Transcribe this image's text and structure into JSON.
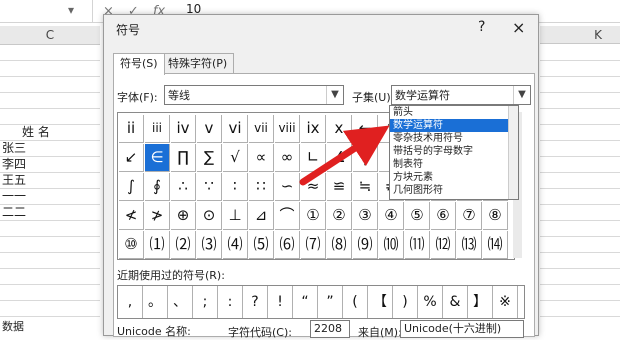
{
  "excel": {
    "name_box_arrow": "▾",
    "cancel": "×",
    "enter": "✓",
    "fx": "fx",
    "formula_value": "10",
    "col_c": "C",
    "col_k": "K",
    "cells": [
      "姓     名",
      "张三",
      "李四",
      "王五",
      "一一",
      "二二"
    ],
    "bottom_left": "数据"
  },
  "dialog": {
    "title": "符号",
    "help": "?",
    "close": "×",
    "tabs": [
      "符号(S)",
      "特殊字符(P)"
    ],
    "font_label": "字体(F):",
    "font_value": "等线",
    "subset_label": "子集(U):",
    "subset_value": "数学运算符",
    "recent_label": "近期使用过的符号(R):",
    "unicode_name_label": "Unicode 名称:",
    "charcode_label": "字符代码(C):",
    "charcode_value": "2208",
    "from_label": "来自(M):",
    "from_value": "Unicode(十六进制)"
  },
  "symbols": [
    [
      "ii",
      "iii",
      "iv",
      "v",
      "vi",
      "vii",
      "viii",
      "ix",
      "x",
      "←",
      "↑",
      "→",
      "↓",
      "↔",
      "↕"
    ],
    [
      "↙",
      "∈",
      "∏",
      "∑",
      "√",
      "∝",
      "∞",
      "∟",
      "∠",
      "∣",
      "∥",
      "∧",
      "∨",
      "∩",
      "∪"
    ],
    [
      "∫",
      "∮",
      "∴",
      "∵",
      "∶",
      "∷",
      "∽",
      "≈",
      "≌",
      "≒",
      "≠",
      "≡",
      "≤",
      "≥",
      "≦"
    ],
    [
      "≮",
      "≯",
      "⊕",
      "⊙",
      "⊥",
      "⊿",
      "⌒",
      "①",
      "②",
      "③",
      "④",
      "⑤",
      "⑥",
      "⑦",
      "⑧"
    ],
    [
      "⑩",
      "⑴",
      "⑵",
      "⑶",
      "⑷",
      "⑸",
      "⑹",
      "⑺",
      "⑻",
      "⑼",
      "⑽",
      "⑾",
      "⑿",
      "⒀",
      "⒁"
    ]
  ],
  "selected_symbol": "∈",
  "subset_list": [
    "箭头",
    "数学运算符",
    "零杂技术用符号",
    "带括号的字母数字",
    "制表符",
    "方块元素",
    "几何图形符"
  ],
  "recent_symbols": [
    ",",
    "。",
    "、",
    ";",
    ":",
    "?",
    "!",
    "“",
    "”",
    "(",
    "【",
    ")",
    "%",
    "&",
    "】",
    "※"
  ],
  "colors": {
    "selection": "#1a6fd6",
    "arrow": "#e02020"
  }
}
